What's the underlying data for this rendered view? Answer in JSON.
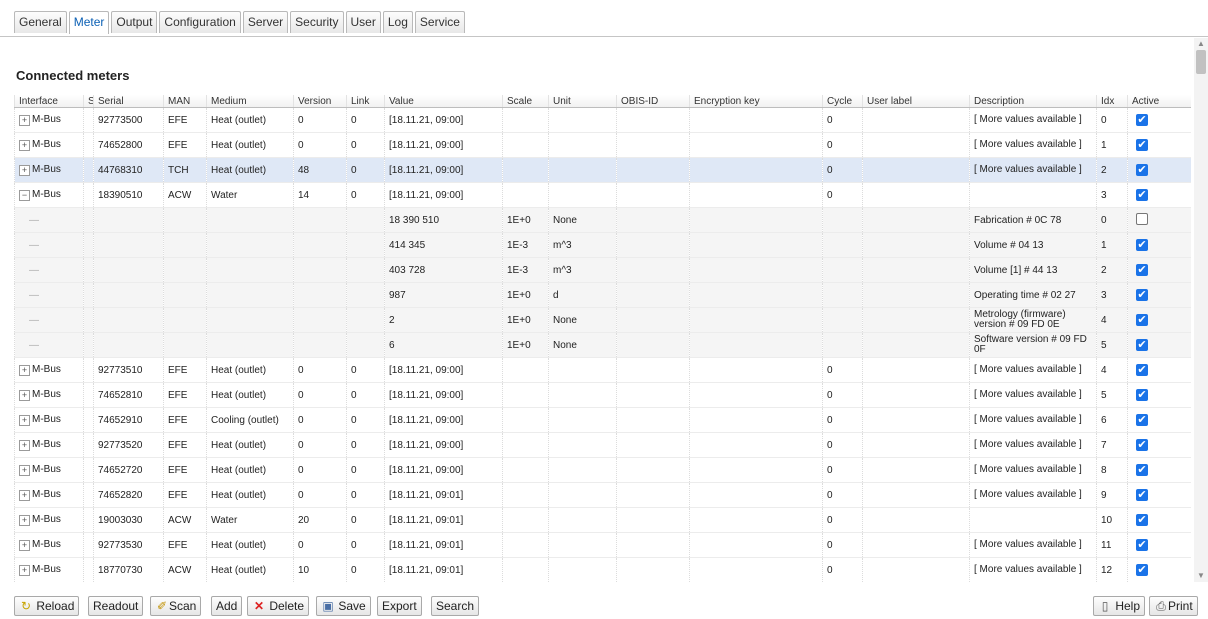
{
  "tabs": [
    "General",
    "Meter",
    "Output",
    "Configuration",
    "Server",
    "Security",
    "User",
    "Log",
    "Service"
  ],
  "active_tab": "Meter",
  "section_title": "Connected meters",
  "columns": [
    "Interface",
    "S",
    "Serial",
    "MAN",
    "Medium",
    "Version",
    "Link",
    "Value",
    "Scale",
    "Unit",
    "OBIS-ID",
    "Encryption key",
    "Cycle",
    "User label",
    "Description",
    "Idx",
    "Active"
  ],
  "rows": [
    {
      "exp": "+",
      "iface": "M-Bus",
      "s": "",
      "serial": "92773500",
      "man": "EFE",
      "medium": "Heat (outlet)",
      "version": "0",
      "link": "0",
      "value": "[18.11.21, 09:00]",
      "scale": "",
      "unit": "",
      "obis": "",
      "enc": "",
      "cycle": "0",
      "label": "",
      "desc": "[ More values available ]",
      "idx": "0",
      "active": true
    },
    {
      "exp": "+",
      "iface": "M-Bus",
      "s": "",
      "serial": "74652800",
      "man": "EFE",
      "medium": "Heat (outlet)",
      "version": "0",
      "link": "0",
      "value": "[18.11.21, 09:00]",
      "scale": "",
      "unit": "",
      "obis": "",
      "enc": "",
      "cycle": "0",
      "label": "",
      "desc": "[ More values available ]",
      "idx": "1",
      "active": true
    },
    {
      "exp": "+",
      "iface": "M-Bus",
      "s": "",
      "serial": "44768310",
      "man": "TCH",
      "medium": "Heat (outlet)",
      "version": "48",
      "link": "0",
      "value": "[18.11.21, 09:00]",
      "scale": "",
      "unit": "",
      "obis": "",
      "enc": "",
      "cycle": "0",
      "label": "",
      "desc": "[ More values available ]",
      "idx": "2",
      "active": true,
      "selected": true
    },
    {
      "exp": "−",
      "iface": "M-Bus",
      "s": "",
      "serial": "18390510",
      "man": "ACW",
      "medium": "Water",
      "version": "14",
      "link": "0",
      "value": "[18.11.21, 09:00]",
      "scale": "",
      "unit": "",
      "obis": "",
      "enc": "",
      "cycle": "0",
      "label": "",
      "desc": "",
      "idx": "3",
      "active": true
    },
    {
      "child": true,
      "value": "18 390 510",
      "scale": "1E+0",
      "unit": "None",
      "desc": "Fabrication # 0C 78",
      "idx": "0",
      "active": false
    },
    {
      "child": true,
      "value": "414 345",
      "scale": "1E-3",
      "unit": "m^3",
      "desc": "Volume # 04 13",
      "idx": "1",
      "active": true
    },
    {
      "child": true,
      "value": "403 728",
      "scale": "1E-3",
      "unit": "m^3",
      "desc": "Volume [1] # 44 13",
      "idx": "2",
      "active": true
    },
    {
      "child": true,
      "value": "987",
      "scale": "1E+0",
      "unit": "d",
      "desc": "Operating time # 02 27",
      "idx": "3",
      "active": true
    },
    {
      "child": true,
      "value": "2",
      "scale": "1E+0",
      "unit": "None",
      "desc": "Metrology (firmware) version # 09 FD 0E",
      "idx": "4",
      "active": true
    },
    {
      "child": true,
      "value": "6",
      "scale": "1E+0",
      "unit": "None",
      "desc": "Software version # 09 FD 0F",
      "idx": "5",
      "active": true
    },
    {
      "exp": "+",
      "iface": "M-Bus",
      "s": "",
      "serial": "92773510",
      "man": "EFE",
      "medium": "Heat (outlet)",
      "version": "0",
      "link": "0",
      "value": "[18.11.21, 09:00]",
      "scale": "",
      "unit": "",
      "obis": "",
      "enc": "",
      "cycle": "0",
      "label": "",
      "desc": "[ More values available ]",
      "idx": "4",
      "active": true
    },
    {
      "exp": "+",
      "iface": "M-Bus",
      "s": "",
      "serial": "74652810",
      "man": "EFE",
      "medium": "Heat (outlet)",
      "version": "0",
      "link": "0",
      "value": "[18.11.21, 09:00]",
      "scale": "",
      "unit": "",
      "obis": "",
      "enc": "",
      "cycle": "0",
      "label": "",
      "desc": "[ More values available ]",
      "idx": "5",
      "active": true
    },
    {
      "exp": "+",
      "iface": "M-Bus",
      "s": "",
      "serial": "74652910",
      "man": "EFE",
      "medium": "Cooling (outlet)",
      "version": "0",
      "link": "0",
      "value": "[18.11.21, 09:00]",
      "scale": "",
      "unit": "",
      "obis": "",
      "enc": "",
      "cycle": "0",
      "label": "",
      "desc": "[ More values available ]",
      "idx": "6",
      "active": true
    },
    {
      "exp": "+",
      "iface": "M-Bus",
      "s": "",
      "serial": "92773520",
      "man": "EFE",
      "medium": "Heat (outlet)",
      "version": "0",
      "link": "0",
      "value": "[18.11.21, 09:00]",
      "scale": "",
      "unit": "",
      "obis": "",
      "enc": "",
      "cycle": "0",
      "label": "",
      "desc": "[ More values available ]",
      "idx": "7",
      "active": true
    },
    {
      "exp": "+",
      "iface": "M-Bus",
      "s": "",
      "serial": "74652720",
      "man": "EFE",
      "medium": "Heat (outlet)",
      "version": "0",
      "link": "0",
      "value": "[18.11.21, 09:00]",
      "scale": "",
      "unit": "",
      "obis": "",
      "enc": "",
      "cycle": "0",
      "label": "",
      "desc": "[ More values available ]",
      "idx": "8",
      "active": true
    },
    {
      "exp": "+",
      "iface": "M-Bus",
      "s": "",
      "serial": "74652820",
      "man": "EFE",
      "medium": "Heat (outlet)",
      "version": "0",
      "link": "0",
      "value": "[18.11.21, 09:01]",
      "scale": "",
      "unit": "",
      "obis": "",
      "enc": "",
      "cycle": "0",
      "label": "",
      "desc": "[ More values available ]",
      "idx": "9",
      "active": true
    },
    {
      "exp": "+",
      "iface": "M-Bus",
      "s": "",
      "serial": "19003030",
      "man": "ACW",
      "medium": "Water",
      "version": "20",
      "link": "0",
      "value": "[18.11.21, 09:01]",
      "scale": "",
      "unit": "",
      "obis": "",
      "enc": "",
      "cycle": "0",
      "label": "",
      "desc": "",
      "idx": "10",
      "active": true
    },
    {
      "exp": "+",
      "iface": "M-Bus",
      "s": "",
      "serial": "92773530",
      "man": "EFE",
      "medium": "Heat (outlet)",
      "version": "0",
      "link": "0",
      "value": "[18.11.21, 09:01]",
      "scale": "",
      "unit": "",
      "obis": "",
      "enc": "",
      "cycle": "0",
      "label": "",
      "desc": "[ More values available ]",
      "idx": "11",
      "active": true
    },
    {
      "exp": "+",
      "iface": "M-Bus",
      "s": "",
      "serial": "18770730",
      "man": "ACW",
      "medium": "Heat (outlet)",
      "version": "10",
      "link": "0",
      "value": "[18.11.21, 09:01]",
      "scale": "",
      "unit": "",
      "obis": "",
      "enc": "",
      "cycle": "0",
      "label": "",
      "desc": "[ More values available ]",
      "idx": "12",
      "active": true
    }
  ],
  "toolbar": {
    "reload": "Reload",
    "readout": "Readout",
    "scan": "Scan",
    "add": "Add",
    "delete": "Delete",
    "save": "Save",
    "export": "Export",
    "search": "Search",
    "help": "Help",
    "print": "Print"
  },
  "icons": {
    "reload": "reload-icon",
    "scan": "scan-icon",
    "delete": "delete-icon",
    "save": "save-icon",
    "help": "help-icon",
    "print": "print-icon"
  },
  "colors": {
    "accent": "#1a73e8",
    "selected_row": "#dfe8f6",
    "child_row": "#f5f5f5",
    "delete_red": "#d22"
  }
}
